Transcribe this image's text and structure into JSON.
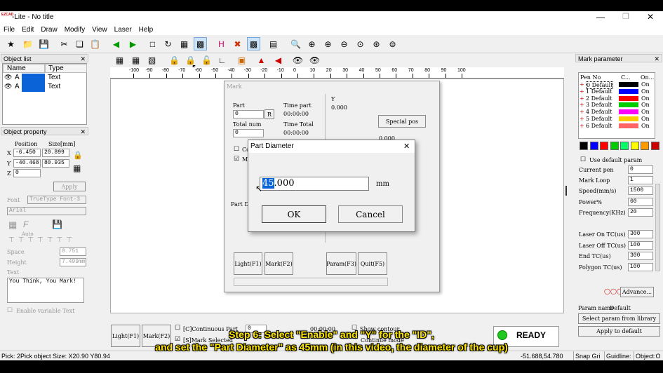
{
  "window": {
    "title": "-Lite - No title",
    "logo_text": "EZCAD"
  },
  "menu": [
    "File",
    "Edit",
    "Draw",
    "Modify",
    "View",
    "Laser",
    "Help"
  ],
  "object_list": {
    "title": "Object list",
    "headers": [
      "Name",
      "Type"
    ],
    "rows": [
      {
        "name": "A",
        "type": "Text"
      },
      {
        "name": "A",
        "type": "Text"
      }
    ]
  },
  "object_property": {
    "title": "Object property",
    "position_label": "Position",
    "size_label": "Size[mm]",
    "x_label": "X",
    "y_label": "Y",
    "z_label": "Z",
    "x_pos": "-6.450",
    "x_size": "20.899",
    "y_pos": "-40.468",
    "y_size": "80.935",
    "z_pos": "0",
    "apply": "Apply",
    "font_label": "Font",
    "font_type": "TrueType Font-3",
    "font_name": "Arial",
    "auto_label": "Auto",
    "space_label": "Space",
    "space_value": "0.751",
    "height_label": "Height",
    "height_value": "7.499mm",
    "text_label": "Text",
    "text_value": "You Think, You Mark!",
    "enable_variable": "Enable variable Text"
  },
  "ruler_ticks": [
    "-100",
    "-90",
    "-80",
    "-70",
    "-60",
    "-50",
    "-40",
    "-30",
    "-20",
    "-10",
    "0",
    "10",
    "20",
    "30",
    "40",
    "50",
    "60",
    "70",
    "80",
    "90",
    "100"
  ],
  "mark_dialog": {
    "title": "Mark",
    "part_label": "Part",
    "part_value": "0",
    "r_button": "R",
    "total_num_label": "Total num",
    "total_num_value": "0",
    "time_part_label": "Time part",
    "time_part_value": "00:00:00",
    "time_total_label": "Time Total",
    "time_total_value": "00:00:00",
    "y_label": "Y",
    "y_value": "0.000",
    "special_pos": "Special pos",
    "small_value": "0.000",
    "continuous_short": "Co",
    "mark_short": "Ma",
    "part_short": "Part D",
    "light_button": "Light(F1)",
    "mark_button": "Mark(F2)",
    "param_button": "Param(F3)",
    "quit_button": "Quit(F5)"
  },
  "part_diameter_dialog": {
    "title": "Part Diameter",
    "value_selected": "45",
    "value_rest": ".000",
    "unit": "mm",
    "ok": "OK",
    "cancel": "Cancel"
  },
  "bottom_controls": {
    "light": "Light(F1)",
    "mark": "Mark(F2)",
    "continuous": "[C]Continuous Part",
    "s_mark": "[S]Mark Selected",
    "part_value": "0",
    "time_value": "00:00:00",
    "show_contour": "Show contour",
    "continue_mode": "Continue mode",
    "ready": "READY"
  },
  "mark_parameter": {
    "title": "Mark parameter",
    "headers": [
      "Pen No",
      "C...",
      "On..."
    ],
    "pens": [
      {
        "name": "0 Default",
        "color": "#000000",
        "on": "On"
      },
      {
        "name": "1 Default",
        "color": "#0000ff",
        "on": "On"
      },
      {
        "name": "2 Default",
        "color": "#ff0000",
        "on": "On"
      },
      {
        "name": "3 Default",
        "color": "#00cc00",
        "on": "On"
      },
      {
        "name": "4 Default",
        "color": "#ff00ff",
        "on": "On"
      },
      {
        "name": "5 Default",
        "color": "#ffcc00",
        "on": "On"
      },
      {
        "name": "6 Default",
        "color": "#ff6666",
        "on": "On"
      }
    ],
    "swatches": [
      "#000000",
      "#0000ff",
      "#ff0000",
      "#00cc00",
      "#00ff66",
      "#ffff00",
      "#ff9900",
      "#cc0000"
    ],
    "use_default": "Use default param",
    "current_pen_label": "Current pen",
    "current_pen": "0",
    "mark_loop_label": "Mark Loop",
    "mark_loop": "1",
    "speed_label": "Speed(mm/s)",
    "speed": "1500",
    "power_label": "Power%",
    "power": "60",
    "frequency_label": "Frequency(KHz)",
    "frequency": "20",
    "laser_on_label": "Laser On TC(us)",
    "laser_on": "300",
    "laser_off_label": "Laser Off TC(us)",
    "laser_off": "100",
    "end_tc_label": "End TC(us)",
    "end_tc": "300",
    "polygon_label": "Polygon TC(us)",
    "polygon": "100",
    "advance": "Advance...",
    "param_name_label": "Param name",
    "param_name": "Default",
    "select_library": "Select param from library",
    "apply_default": "Apply to default"
  },
  "status": {
    "left": "Pick: 2Pick object Size: X20.90 Y80.94",
    "coords": "-51.688,54.780",
    "snap": "Snap Gri",
    "guideline": "Guidline:",
    "object": "Object:O"
  },
  "subtitles": {
    "line1": "Step 6: Select \"Enable\" and \"Y\" for the \"ID\",",
    "line2": "and set the \"Part Diameter\" as 45mm (in this video, the diameter of the cup)"
  }
}
